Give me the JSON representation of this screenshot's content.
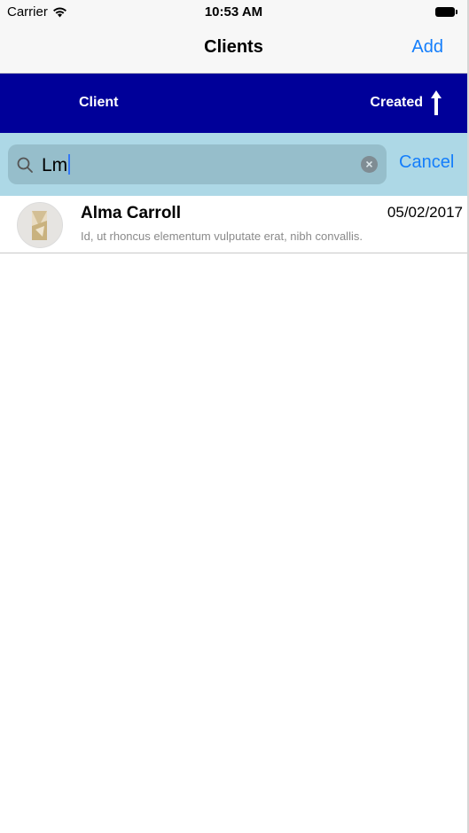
{
  "status_bar": {
    "carrier": "Carrier",
    "time": "10:53 AM"
  },
  "nav": {
    "title": "Clients",
    "add_label": "Add"
  },
  "sort_header": {
    "client_label": "Client",
    "created_label": "Created",
    "direction": "ascending"
  },
  "search": {
    "query": "Lm",
    "cancel_label": "Cancel"
  },
  "colors": {
    "header_bg": "#000099",
    "search_bg": "#add8e6",
    "accent": "#147efb"
  },
  "results": [
    {
      "name": "Alma Carroll",
      "date": "05/02/2017",
      "description": "Id, ut rhoncus elementum vulputate erat, nibh convallis."
    }
  ]
}
